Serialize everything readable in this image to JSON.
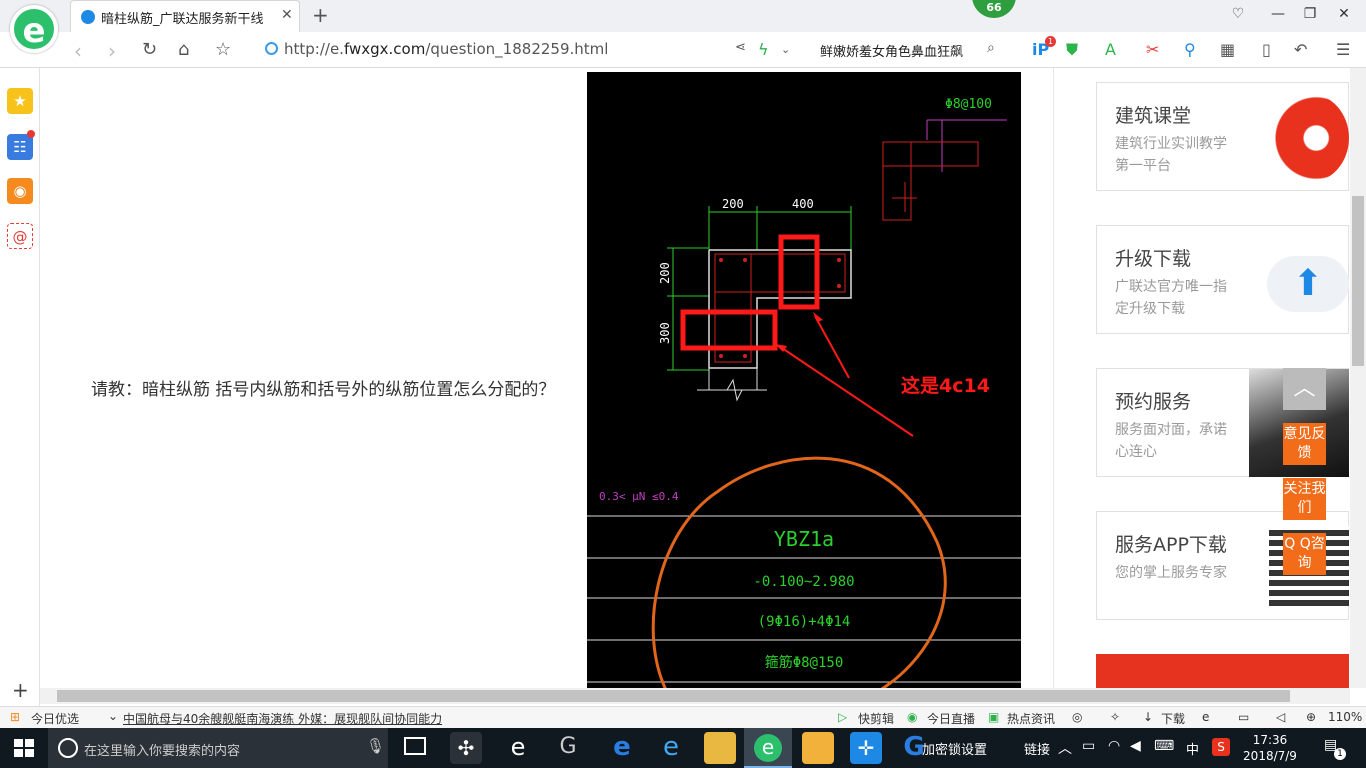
{
  "browser": {
    "tab_title": "暗柱纵筋_广联达服务新干线",
    "badge": "66",
    "url_prefix": "http://e.",
    "url_domain": "fwxgx.com",
    "url_path": "/question_1882259.html",
    "search_text": "鲜嫩娇羞女角色鼻血狂飙",
    "ext_badge": "1"
  },
  "page": {
    "question": "请教：暗柱纵筋 括号内纵筋和括号外的纵筋位置怎么分配的？"
  },
  "drawing": {
    "stirrup_top": "Φ8@100",
    "dim_200_top": "200",
    "dim_400": "400",
    "dim_200_left": "200",
    "dim_300_left": "300",
    "annotation": "这是4c14",
    "range": "0.3< μN ≤0.4",
    "col_name": "YBZ1a",
    "elevation": "-0.100~2.980",
    "rebar": "(9Φ16)+4Φ14",
    "stirrup": "箍筋Φ8@150"
  },
  "cards": [
    {
      "title": "建筑课堂",
      "sub": "建筑行业实训教学第一平台"
    },
    {
      "title": "升级下载",
      "sub": "广联达官方唯一指定升级下载"
    },
    {
      "title": "预约服务",
      "sub": "服务面对面，承诺心连心"
    },
    {
      "title": "服务APP下载",
      "sub": "您的掌上服务专家"
    }
  ],
  "float": {
    "feedback": "意见反馈",
    "follow": "关注我们",
    "qq": "Q Q咨询"
  },
  "statusbar": {
    "today": "今日优选",
    "news": "中国航母与40余艘舰艇南海演练 外媒：展现舰队间协同能力",
    "kuaijian": "快剪辑",
    "live": "今日直播",
    "hot": "热点资讯",
    "download": "下载",
    "zoom": "110%"
  },
  "taskbar": {
    "search_placeholder": "在这里输入你要搜索的内容",
    "tray_text1": "加密锁设置",
    "tray_text2": "链接",
    "ime": "中",
    "time": "17:36",
    "date": "2018/7/9",
    "notif": "1"
  }
}
